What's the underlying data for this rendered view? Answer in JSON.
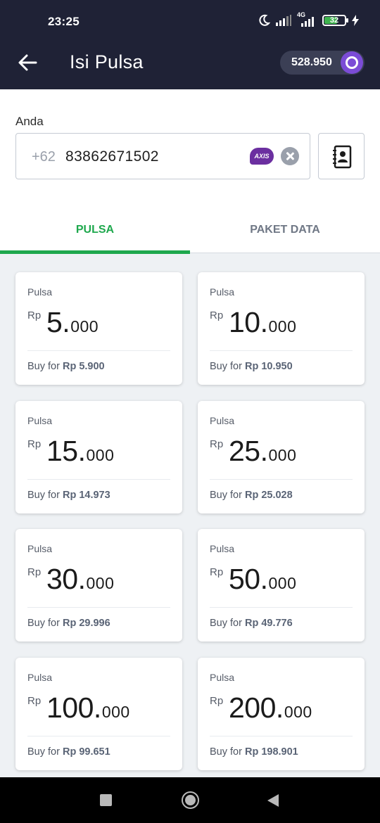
{
  "status": {
    "time": "23:25",
    "network": "4G",
    "battery": "32",
    "icons": [
      "moon-icon",
      "signal-icon",
      "signal-4g-icon",
      "battery-icon",
      "charging-icon"
    ]
  },
  "header": {
    "title": "Isi Pulsa",
    "points": "528.950"
  },
  "form": {
    "label": "Anda",
    "prefix": "+62",
    "number": "83862671502",
    "operator": "AXIS"
  },
  "tabs": [
    {
      "label": "PULSA",
      "active": true
    },
    {
      "label": "PAKET DATA",
      "active": false
    }
  ],
  "products": [
    {
      "kind": "Pulsa",
      "currency": "Rp",
      "main": "5.",
      "suffix": "000",
      "buy_prefix": "Buy for",
      "price": "Rp 5.900"
    },
    {
      "kind": "Pulsa",
      "currency": "Rp",
      "main": "10.",
      "suffix": "000",
      "buy_prefix": "Buy for",
      "price": "Rp 10.950"
    },
    {
      "kind": "Pulsa",
      "currency": "Rp",
      "main": "15.",
      "suffix": "000",
      "buy_prefix": "Buy for",
      "price": "Rp 14.973"
    },
    {
      "kind": "Pulsa",
      "currency": "Rp",
      "main": "25.",
      "suffix": "000",
      "buy_prefix": "Buy for",
      "price": "Rp 25.028"
    },
    {
      "kind": "Pulsa",
      "currency": "Rp",
      "main": "30.",
      "suffix": "000",
      "buy_prefix": "Buy for",
      "price": "Rp 29.996"
    },
    {
      "kind": "Pulsa",
      "currency": "Rp",
      "main": "50.",
      "suffix": "000",
      "buy_prefix": "Buy for",
      "price": "Rp 49.776"
    },
    {
      "kind": "Pulsa",
      "currency": "Rp",
      "main": "100.",
      "suffix": "000",
      "buy_prefix": "Buy for",
      "price": "Rp 99.651"
    },
    {
      "kind": "Pulsa",
      "currency": "Rp",
      "main": "200.",
      "suffix": "000",
      "buy_prefix": "Buy for",
      "price": "Rp 198.901"
    }
  ],
  "colors": {
    "header_bg": "#1f2236",
    "accent_green": "#1ea84d",
    "points_coin": "#7b4cd6",
    "axis_purple": "#6b2fa0"
  }
}
